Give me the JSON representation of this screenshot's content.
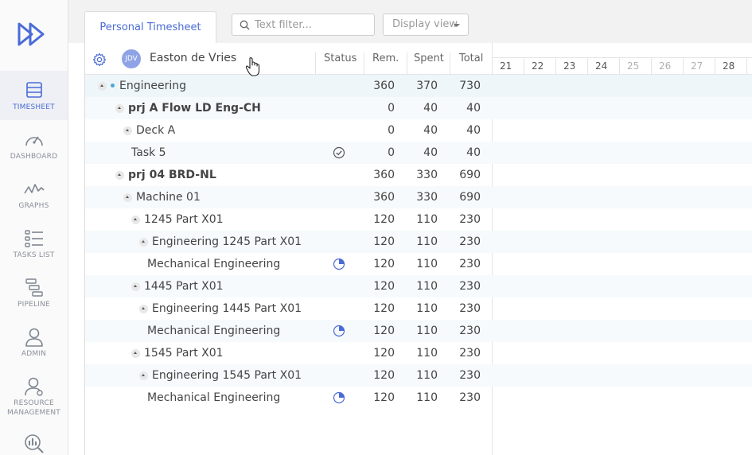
{
  "sidebar": {
    "items": [
      {
        "label": "TIMESHEET",
        "icon": "timesheet-icon",
        "active": true
      },
      {
        "label": "DASHBOARD",
        "icon": "dashboard-gauge-icon"
      },
      {
        "label": "GRAPHS",
        "icon": "graphs-line-icon"
      },
      {
        "label": "TASKS LIST",
        "icon": "tasks-list-icon"
      },
      {
        "label": "PIPELINE",
        "icon": "pipeline-icon"
      },
      {
        "label": "ADMIN",
        "icon": "admin-user-icon"
      },
      {
        "label": "RESOURCE MANAGEMENT",
        "icon": "resource-management-icon"
      }
    ]
  },
  "header": {
    "tab_label": "Personal Timesheet",
    "filter_placeholder": "Text filter...",
    "display_view_label": "Display view"
  },
  "table": {
    "user": {
      "initials": "JDV",
      "name": "Easton de Vries"
    },
    "columns": {
      "status": "Status",
      "rem": "Rem.",
      "spent": "Spent",
      "total": "Total"
    },
    "days": [
      "21",
      "22",
      "23",
      "24",
      "25",
      "26",
      "27",
      "28"
    ],
    "rows": [
      {
        "name": "Engineering",
        "rem": "360",
        "spent": "370",
        "total": "730",
        "status": ""
      },
      {
        "name": "prj A Flow LD Eng-CH",
        "rem": "0",
        "spent": "40",
        "total": "40",
        "status": ""
      },
      {
        "name": "Deck A",
        "rem": "0",
        "spent": "40",
        "total": "40",
        "status": ""
      },
      {
        "name": "Task 5",
        "rem": "0",
        "spent": "40",
        "total": "40",
        "status": "completed-check-icon"
      },
      {
        "name": "prj 04 BRD-NL",
        "rem": "360",
        "spent": "330",
        "total": "690",
        "status": ""
      },
      {
        "name": "Machine 01",
        "rem": "360",
        "spent": "330",
        "total": "690",
        "status": ""
      },
      {
        "name": "1245 Part X01",
        "rem": "120",
        "spent": "110",
        "total": "230",
        "status": ""
      },
      {
        "name": "Engineering 1245 Part X01",
        "rem": "120",
        "spent": "110",
        "total": "230",
        "status": ""
      },
      {
        "name": "Mechanical Engineering",
        "rem": "120",
        "spent": "110",
        "total": "230",
        "status": "in-progress-pie-icon"
      },
      {
        "name": "1445 Part X01",
        "rem": "120",
        "spent": "110",
        "total": "230",
        "status": ""
      },
      {
        "name": "Engineering 1445 Part X01",
        "rem": "120",
        "spent": "110",
        "total": "230",
        "status": ""
      },
      {
        "name": "Mechanical Engineering",
        "rem": "120",
        "spent": "110",
        "total": "230",
        "status": "in-progress-pie-icon"
      },
      {
        "name": "1545 Part X01",
        "rem": "120",
        "spent": "110",
        "total": "230",
        "status": ""
      },
      {
        "name": "Engineering 1545 Part X01",
        "rem": "120",
        "spent": "110",
        "total": "230",
        "status": ""
      },
      {
        "name": "Mechanical Engineering",
        "rem": "120",
        "spent": "110",
        "total": "230",
        "status": "in-progress-pie-icon"
      }
    ]
  },
  "colors": {
    "accent": "#4a6bd6",
    "dot": "#4aa8d8"
  }
}
